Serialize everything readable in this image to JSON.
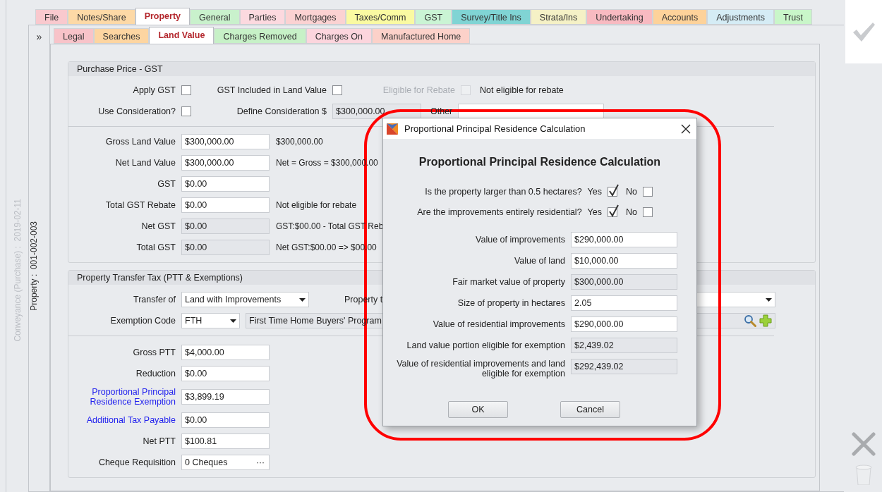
{
  "main_tabs": [
    {
      "label": "File",
      "color": "#f9c9ce",
      "selected": false
    },
    {
      "label": "Notes/Share",
      "color": "#fdd9a6",
      "selected": false
    },
    {
      "label": "Property",
      "color": "#ffffff",
      "selected": true
    },
    {
      "label": "General",
      "color": "#c9f1cc",
      "selected": false
    },
    {
      "label": "Parties",
      "color": "#fcd9df",
      "selected": false
    },
    {
      "label": "Mortgages",
      "color": "#fbd2d2",
      "selected": false
    },
    {
      "label": "Taxes/Comm",
      "color": "#fafaa2",
      "selected": false
    },
    {
      "label": "GST",
      "color": "#caf4d4",
      "selected": false
    },
    {
      "label": "Survey/Title Ins",
      "color": "#80d4d4",
      "selected": false
    },
    {
      "label": "Strata/Ins",
      "color": "#f5f1c6",
      "selected": false
    },
    {
      "label": "Undertaking",
      "color": "#f8bac1",
      "selected": false
    },
    {
      "label": "Accounts",
      "color": "#fdd29a",
      "selected": false
    },
    {
      "label": "Adjustments",
      "color": "#d5ecf5",
      "selected": false
    },
    {
      "label": "Trust",
      "color": "#c9f6c9",
      "selected": false
    }
  ],
  "sub_tabs": [
    {
      "label": "Legal",
      "color": "#f8c3c9",
      "selected": false
    },
    {
      "label": "Searches",
      "color": "#fdd5a1",
      "selected": false
    },
    {
      "label": "Land Value",
      "color": "#ffffff",
      "selected": true
    },
    {
      "label": "Charges Removed",
      "color": "#c7f1c7",
      "selected": false
    },
    {
      "label": "Charges On",
      "color": "#fcd5dd",
      "selected": false
    },
    {
      "label": "Manufactured Home",
      "color": "#fcd1c9",
      "selected": false
    }
  ],
  "expand_button": "»",
  "side_labels": {
    "conveyance": "Conveyance (Purchase) :  2019-02-11",
    "property": "Property :  001-002-003"
  },
  "purchase_gst": {
    "title": "Purchase Price - GST",
    "apply_gst": {
      "label": "Apply GST",
      "checked": false
    },
    "gst_included": {
      "label": "GST Included in Land Value",
      "checked": false
    },
    "eligible_rebate": {
      "label": "Eligible for Rebate",
      "checked": false,
      "disabled": true
    },
    "rebate_status": "Not eligible for rebate",
    "use_consideration": {
      "label": "Use Consideration?",
      "checked": false
    },
    "define_consideration": {
      "label": "Define Consideration $",
      "value": "$300,000.00",
      "readonly": true
    },
    "other": {
      "label": "Other"
    },
    "rows": [
      {
        "label": "Gross Land Value",
        "value": "$300,000.00",
        "readonly": false,
        "note": "$300,000.00"
      },
      {
        "label": "Net Land Value",
        "value": "$300,000.00",
        "readonly": false,
        "note": "Net = Gross = $300,000.00"
      },
      {
        "label": "GST",
        "value": "$0.00",
        "readonly": false
      },
      {
        "label": "Total GST Rebate",
        "value": "$0.00",
        "readonly": false,
        "note": "Not eligible for rebate"
      },
      {
        "label": "Net GST",
        "value": "$0.00",
        "readonly": true,
        "note": "GST:$00.00 - Total GST Reb"
      },
      {
        "label": "Total GST",
        "value": "$0.00",
        "readonly": true,
        "note": "Net GST:$00.00 => $00.00"
      }
    ]
  },
  "ptt": {
    "title": "Property Transfer Tax (PTT & Exemptions)",
    "transfer_of": {
      "label": "Transfer of",
      "value": "Land with Improvements"
    },
    "property_type": {
      "label": "Property t"
    },
    "exemption_code": {
      "label": "Exemption Code",
      "code": "FTH",
      "description": "First Time Home Buyers' Program"
    },
    "rows": [
      {
        "kind": "field",
        "label": "Gross PTT",
        "value": "$4,000.00",
        "link": false
      },
      {
        "kind": "field",
        "label": "Reduction",
        "value": "$0.00",
        "link": false
      },
      {
        "kind": "field",
        "label": "Proportional Principal Residence Exemption",
        "value": "$3,899.19",
        "link": true
      },
      {
        "kind": "field",
        "label": "Additional Tax Payable",
        "value": "$0.00",
        "link": true
      },
      {
        "kind": "field",
        "label": "Net PTT",
        "value": "$100.81",
        "link": false
      },
      {
        "kind": "picker",
        "label": "Cheque Requisition",
        "value": "0 Cheques",
        "button": "···",
        "link": false
      }
    ]
  },
  "dialog": {
    "title": "Proportional Principal Residence Calculation",
    "heading": "Proportional Principal Residence Calculation",
    "questions": [
      {
        "text": "Is the property larger than 0.5 hectares?",
        "yes_label": "Yes",
        "yes_checked": true,
        "no_label": "No",
        "no_checked": false
      },
      {
        "text": "Are the improvements entirely residential?",
        "yes_label": "Yes",
        "yes_checked": true,
        "no_label": "No",
        "no_checked": false
      }
    ],
    "fields": [
      {
        "label": "Value of improvements",
        "value": "$290,000.00",
        "readonly": false
      },
      {
        "label": "Value of land",
        "value": "$10,000.00",
        "readonly": false
      },
      {
        "label": "Fair market value of property",
        "value": "$300,000.00",
        "readonly": true
      },
      {
        "label": "Size of property in hectares",
        "value": "2.05",
        "readonly": false
      },
      {
        "label": "Value of residential improvements",
        "value": "$290,000.00",
        "readonly": false
      },
      {
        "label": "Land value portion eligible for exemption",
        "value": "$2,439.02",
        "readonly": true
      },
      {
        "label": "Value of residential improvements and land eligible for exemption",
        "value": "$292,439.02",
        "readonly": true
      }
    ],
    "buttons": [
      "OK",
      "Cancel"
    ]
  }
}
